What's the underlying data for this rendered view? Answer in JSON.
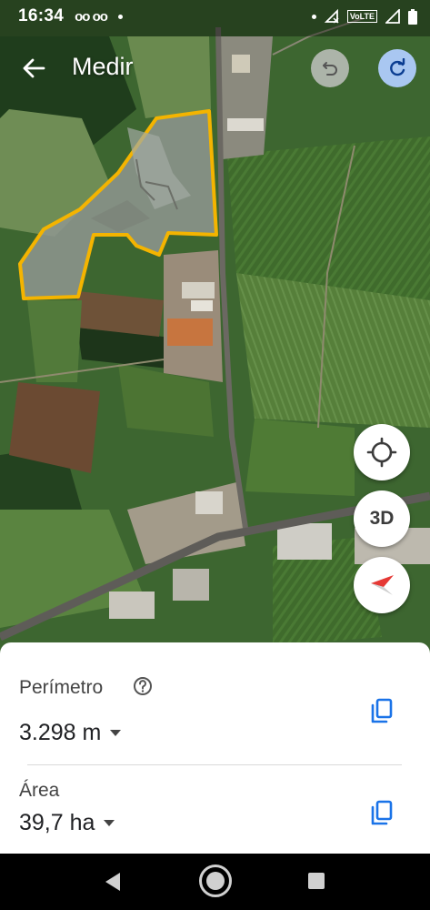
{
  "status_bar": {
    "time": "16:34",
    "voicemail": "oo oo",
    "network_badge": "VoLTE"
  },
  "app_bar": {
    "title": "Medir",
    "back_icon": "arrow-back-icon",
    "undo_icon": "undo-icon",
    "redo_icon": "redo-icon"
  },
  "map_controls": {
    "location_icon": "my-location-icon",
    "threeD_label": "3D",
    "compass_icon": "compass-icon"
  },
  "measurement": {
    "perimeter": {
      "label": "Perímetro",
      "value": "3.298 m"
    },
    "area": {
      "label": "Área",
      "value": "39,7 ha"
    }
  },
  "colors": {
    "polygon_outline": "#f4b400",
    "redo_button_bg": "#a9c7f1",
    "copy_icon": "#1a73e8",
    "compass_red": "#e53935"
  }
}
